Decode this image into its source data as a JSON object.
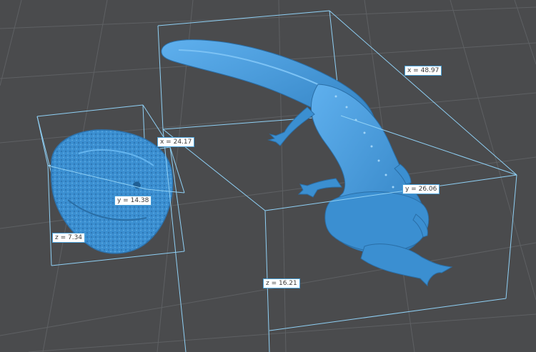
{
  "colors": {
    "background": "#4a4b4d",
    "grid_line": "#5e6063",
    "model_fill": "#3b8fd1",
    "bbox_line": "#8fd0f5",
    "label_bg": "#ffffff",
    "label_text": "#3a3a3a"
  },
  "models": {
    "rock": {
      "icon": "rock-model",
      "labels": {
        "x": "x = 24.17",
        "y": "y = 14.38",
        "z": "z = 7.34"
      }
    },
    "salamander": {
      "icon": "salamander-model",
      "labels": {
        "x": "x = 48.97",
        "y": "y = 26.06",
        "z": "z = 16.21"
      }
    }
  }
}
